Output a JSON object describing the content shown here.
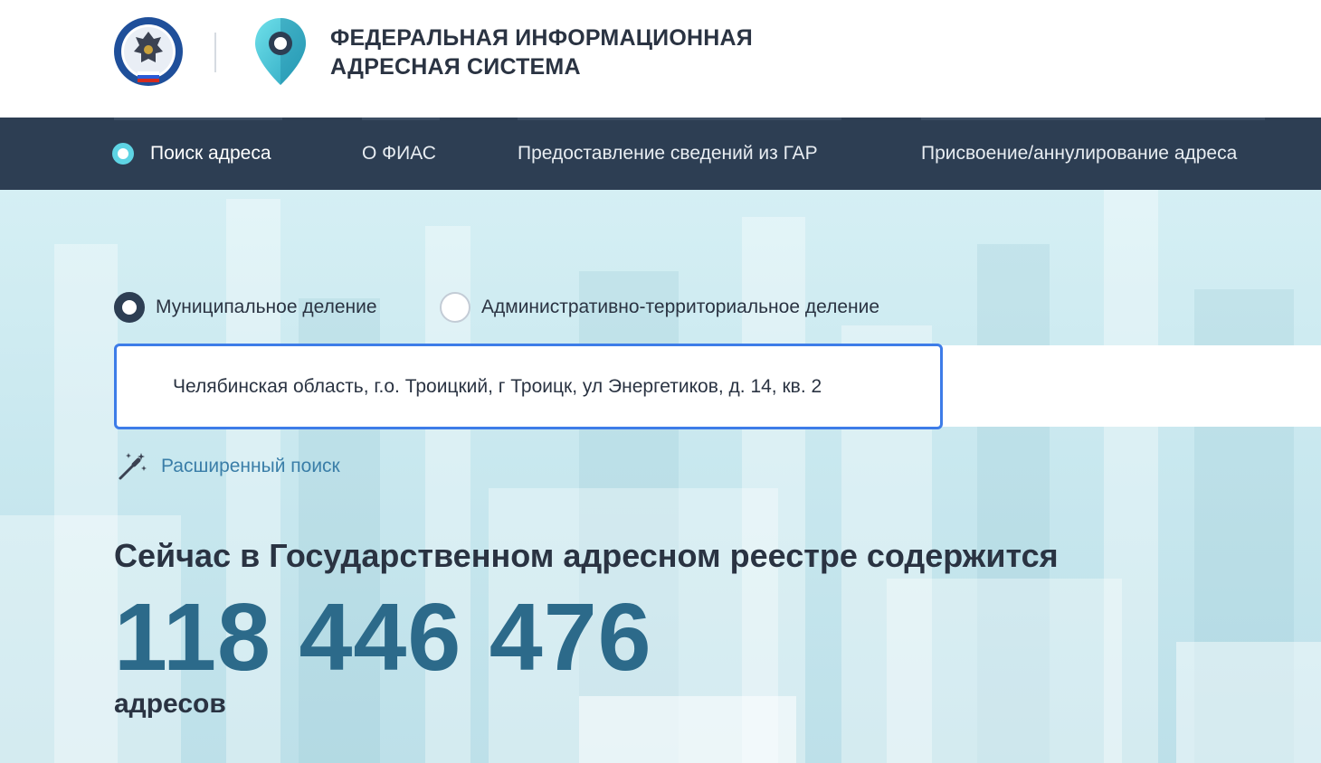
{
  "header": {
    "title_line1": "ФЕДЕРАЛЬНАЯ ИНФОРМАЦИОННАЯ",
    "title_line2": "АДРЕСНАЯ СИСТЕМА"
  },
  "nav": {
    "items": [
      {
        "label": "Поиск адреса",
        "active": true
      },
      {
        "label": "О ФИАС"
      },
      {
        "label": "Предоставление сведений из ГАР"
      },
      {
        "label": "Присвоение/аннулирование адреса"
      }
    ]
  },
  "search": {
    "modes": [
      {
        "label": "Муниципальное деление",
        "checked": true
      },
      {
        "label": "Административно-территориальное деление",
        "checked": false
      }
    ],
    "value": "Челябинская область, г.о. Троицкий, г Троицк, ул Энергетиков, д. 14, кв. 2",
    "advanced_label": "Расширенный поиск"
  },
  "stats": {
    "title": "Сейчас в Государственном адресном реестре содержится",
    "count": "118 446 476",
    "unit": "адресов"
  },
  "colors": {
    "nav_bg": "#2d3e53",
    "accent_cyan": "#5ed4e4",
    "focus_border": "#3d7ce8",
    "number": "#2c6a8a",
    "link": "#3a7ea8"
  }
}
